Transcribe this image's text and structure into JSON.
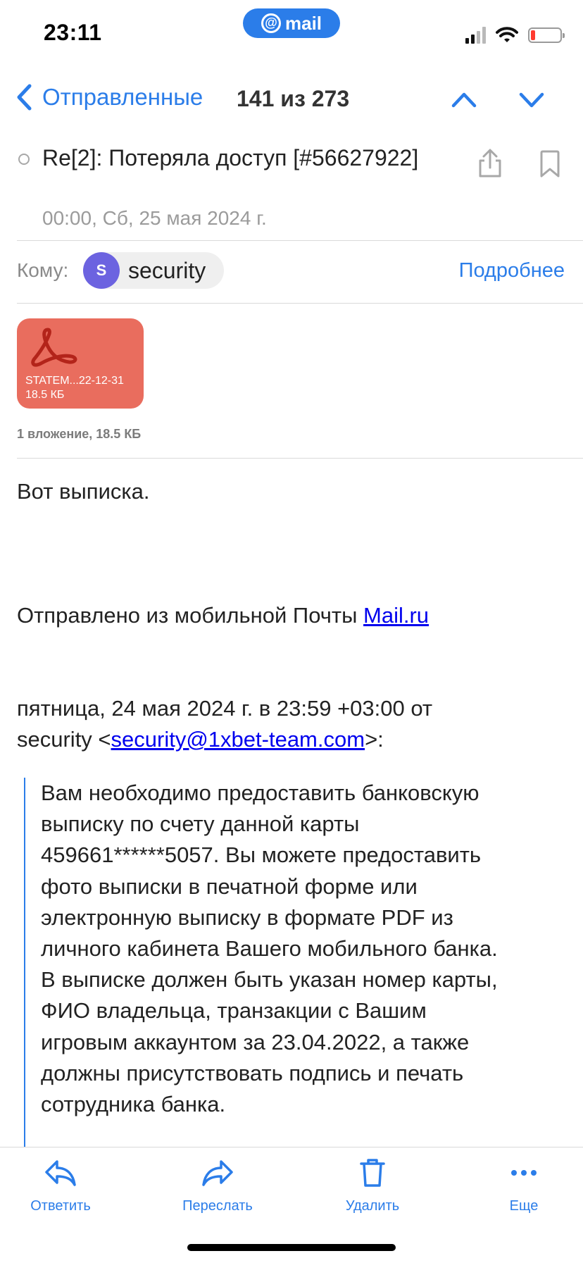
{
  "status_bar": {
    "time": "23:11",
    "center_pill": "mail",
    "battery_level": 0.15
  },
  "nav": {
    "back_label": "Отправленные",
    "counter": "141 из 273"
  },
  "message": {
    "subject": "Re[2]: Потеряла доступ [#56627922]",
    "date": "00:00, Сб, 25 мая 2024 г.",
    "to_label": "Кому:",
    "recipient_initial": "S",
    "recipient_name": "security",
    "details_label": "Подробнее"
  },
  "attachment": {
    "name": "STATEM...22-12-31",
    "size": "18.5 КБ",
    "summary": "1 вложение, 18.5 КБ"
  },
  "body": {
    "line1": "Вот выписка.",
    "signature_prefix": "Отправлено из мобильной Почты ",
    "signature_link": "Mail.ru",
    "quote_header_line1": "пятница, 24 мая 2024 г. в 23:59 +03:00 от",
    "quote_header_prefix": "security <",
    "quote_header_email": "security@1xbet-team.com",
    "quote_header_suffix": ">:",
    "quote_lines": [
      "Вам необходимо предоставить банковскую",
      "выписку по счету данной карты",
      "459661******5057. Вы можете предоставить",
      "фото выписки в печатной форме или",
      "электронную выписку в формате PDF из",
      "личного кабинета Вашего мобильного банка.",
      "В выписке должен быть указан номер карты,",
      "ФИО владельца, транзакции с Вашим",
      "игровым аккаунтом за 23.04.2022, а также",
      "должны присутствовать подпись и печать",
      "сотрудника банка."
    ]
  },
  "toolbar": {
    "reply": "Ответить",
    "forward": "Переслать",
    "delete": "Удалить",
    "more": "Еще"
  },
  "colors": {
    "accent": "#2b7de9",
    "attachment_bg": "#e96d5e",
    "avatar_bg": "#6c63e0",
    "battery_low": "#ff3b30"
  }
}
